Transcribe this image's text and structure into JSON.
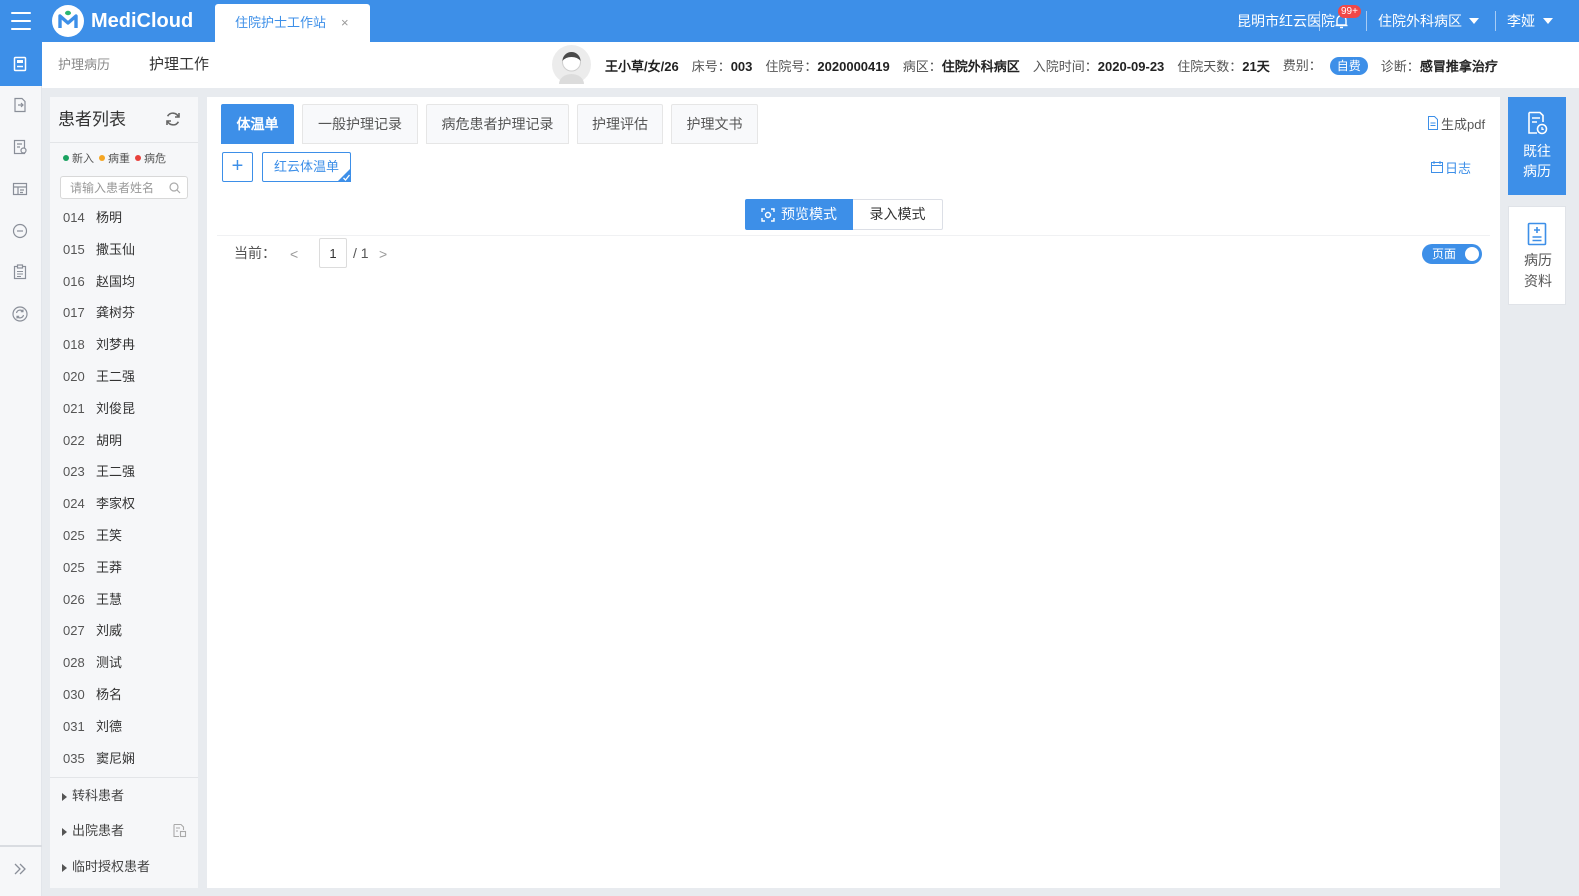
{
  "colors": {
    "primary": "#3d8fe8",
    "badge": "#f04848"
  },
  "topbar": {
    "menu_icon": "hamburger-menu-icon",
    "logo_icon": "medicloud-logo-icon",
    "app_name": "MediCloud",
    "open_tab": {
      "label": "住院护士工作站",
      "close": "×"
    },
    "hospital": "昆明市红云医院",
    "notification_icon": "bell-icon",
    "notification_count": "99+",
    "ward": "住院外科病区",
    "user": "李娅"
  },
  "left_nav": {
    "active_icon": "nursing-record-icon",
    "icons": [
      "document-transfer-icon",
      "document-check-icon",
      "table-search-icon",
      "minus-circle-icon",
      "clipboard-list-icon",
      "sync-circle-icon"
    ],
    "expand_icon": "double-chevron-right-icon"
  },
  "subheader": {
    "breadcrumb": "护理病历",
    "title": "护理工作"
  },
  "patient_info": {
    "avatar_icon": "patient-avatar-icon",
    "name_gender_age": "王小草/女/26",
    "fields": [
      {
        "label": "床号：",
        "value": "003"
      },
      {
        "label": "住院号：",
        "value": "2020000419"
      },
      {
        "label": "病区：",
        "value": "住院外科病区"
      },
      {
        "label": "入院时间：",
        "value": "2020-09-23"
      },
      {
        "label": "住院天数：",
        "value": "21天"
      },
      {
        "label": "费别：",
        "value": "自费"
      },
      {
        "label": "诊断：",
        "value": "感冒推拿治疗"
      }
    ]
  },
  "patient_list": {
    "title": "患者列表",
    "refresh_icon": "refresh-icon",
    "legend": [
      {
        "label": "新入",
        "color": "#1aa260"
      },
      {
        "label": "病重",
        "color": "#f5a623"
      },
      {
        "label": "病危",
        "color": "#e8413c"
      }
    ],
    "search_placeholder": "请输入患者姓名",
    "patients": [
      {
        "bed": "014",
        "name": "杨明"
      },
      {
        "bed": "015",
        "name": "撒玉仙"
      },
      {
        "bed": "016",
        "name": "赵国均"
      },
      {
        "bed": "017",
        "name": "龚树芬"
      },
      {
        "bed": "018",
        "name": "刘梦冉"
      },
      {
        "bed": "020",
        "name": "王二强"
      },
      {
        "bed": "021",
        "name": "刘俊昆"
      },
      {
        "bed": "022",
        "name": "胡明"
      },
      {
        "bed": "023",
        "name": "王二强"
      },
      {
        "bed": "024",
        "name": "李家权"
      },
      {
        "bed": "025",
        "name": "王笑"
      },
      {
        "bed": "025",
        "name": "王莽"
      },
      {
        "bed": "026",
        "name": "王慧"
      },
      {
        "bed": "027",
        "name": "刘威"
      },
      {
        "bed": "028",
        "name": "测试"
      },
      {
        "bed": "030",
        "name": "杨名"
      },
      {
        "bed": "031",
        "name": "刘德"
      },
      {
        "bed": "035",
        "name": "窦尼娴"
      }
    ],
    "groups": [
      "转科患者",
      "出院患者",
      "临时授权患者"
    ]
  },
  "main": {
    "tabs": [
      "体温单",
      "一般护理记录",
      "病危患者护理记录",
      "护理评估",
      "护理文书"
    ],
    "active_tab": 0,
    "generate_pdf": "生成pdf",
    "add_button": "+",
    "template_button": "红云体温单",
    "log": "日志",
    "modes": [
      "预览模式",
      "录入模式"
    ],
    "active_mode": 0,
    "pager": {
      "label": "当前：",
      "prev": "<",
      "current": "1",
      "total": "/ 1",
      "next": ">"
    },
    "page_toggle": {
      "label": "页面",
      "on": true
    }
  },
  "right_panel": {
    "items": [
      {
        "lines": [
          "既往",
          "病历"
        ],
        "icon": "history-record-icon",
        "active": true
      },
      {
        "lines": [
          "病历",
          "资料"
        ],
        "icon": "record-document-icon",
        "active": false
      }
    ]
  }
}
